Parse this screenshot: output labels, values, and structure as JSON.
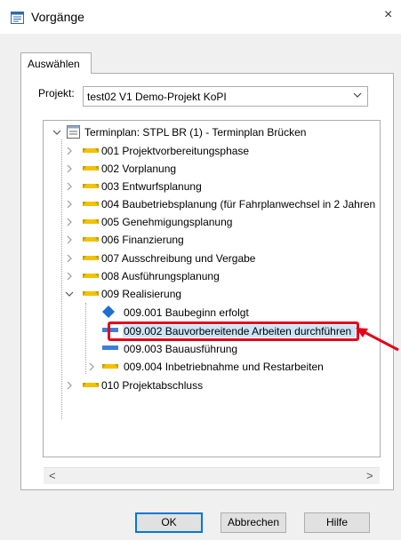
{
  "window": {
    "title": "Vorgänge",
    "close_glyph": "×"
  },
  "tabs": [
    {
      "label": "Auswählen"
    }
  ],
  "project": {
    "label": "Projekt:",
    "value": "test02 V1 Demo-Projekt KoPI"
  },
  "tree": {
    "root": {
      "label": "Terminplan: STPL BR (1) - Terminplan Brücken"
    },
    "phases": [
      {
        "label": "001 Projektvorbereitungsphase"
      },
      {
        "label": "002 Vorplanung"
      },
      {
        "label": "003 Entwurfsplanung"
      },
      {
        "label": "004 Baubetriebsplanung (für Fahrplanwechsel in 2 Jahren"
      },
      {
        "label": "005 Genehmigungsplanung"
      },
      {
        "label": "006 Finanzierung"
      },
      {
        "label": "007 Ausschreibung und Vergabe"
      },
      {
        "label": "008 Ausführungsplanung"
      },
      {
        "label": "009 Realisierung"
      }
    ],
    "children_009": [
      {
        "label": "009.001 Baubeginn erfolgt",
        "icon": "milestone-diamond-icon"
      },
      {
        "label": "009.002 Bauvorbereitende Arbeiten durchführen",
        "icon": "task-bar-icon",
        "selected": true
      },
      {
        "label": "009.003 Bauausführung",
        "icon": "task-bar-icon"
      },
      {
        "label": "009.004 Inbetriebnahme und Restarbeiten",
        "icon": "summary-bar-icon"
      }
    ],
    "last_phase": {
      "label": "010 Projektabschluss"
    }
  },
  "scrollbar": {
    "left_glyph": "<",
    "right_glyph": ">"
  },
  "buttons": {
    "ok": "OK",
    "cancel": "Abbrechen",
    "help": "Hilfe"
  },
  "colors": {
    "highlight_border": "#e3001b",
    "selection_bg": "#cce4f7",
    "summary_bar": "#f2c200",
    "task_bar": "#3d7fd9",
    "milestone": "#1f6fd1"
  }
}
